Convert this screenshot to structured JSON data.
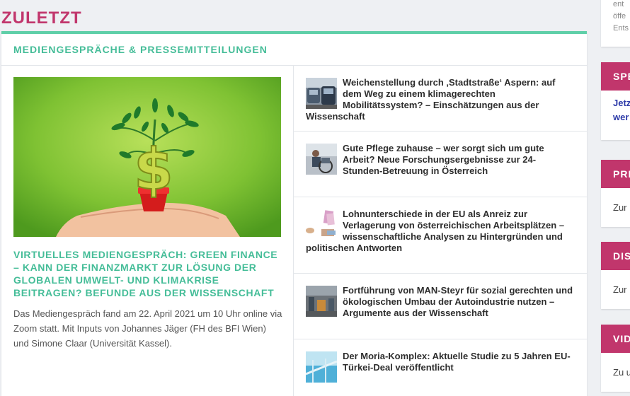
{
  "section": {
    "title": "ZULETZT"
  },
  "card": {
    "header": "MEDIENGESPRÄCHE & PRESSEMITTEILUNGEN",
    "featured": {
      "image": "green-finance-plant-dollar-image",
      "title": "VIRTUELLES MEDIENGESPRÄCH: GREEN FINANCE – KANN DER FINANZMARKT ZUR LÖSUNG DER GLOBALEN UMWELT- UND KLIMAKRISE BEITRAGEN? BEFUNDE AUS DER WISSENSCHAFT",
      "text": "Das Mediengespräch fand am 22. April 2021 um 10 Uhr online via Zoom statt. Mit Inputs von Johannes Jäger (FH des BFI Wien) und Simone Claar (Universität Kassel)."
    },
    "items": [
      {
        "thumb": "traffic-cars-thumbnail",
        "title": "Weichenstellung durch ‚Stadtstraße‘ Aspern: auf dem Weg zu einem klimagerechten Mobilitätssystem? – Einschätzungen aus der Wissenschaft"
      },
      {
        "thumb": "wheelchair-care-thumbnail",
        "title": "Gute Pflege zuhause – wer sorgt sich um gute Arbeit? Neue Forschungsergebnisse zur 24-Stunden-Betreuung in Österreich"
      },
      {
        "thumb": "euro-banknotes-thumbnail",
        "title": "Lohnunterschiede in der EU als Anreiz zur Verlagerung von österreichischen Arbeitsplätzen – wissenschaftliche Analysen zu Hintergründen und politischen Antworten"
      },
      {
        "thumb": "factory-hall-thumbnail",
        "title": "Fortführung von MAN-Steyr für sozial gerechten und ökologischen Umbau der Autoindustrie nutzen – Argumente aus der Wissenschaft"
      },
      {
        "thumb": "fence-sky-thumbnail",
        "title": "Der Moria-Komplex: Aktuelle Studie zu 5 Jahren EU-Türkei-Deal veröffentlicht"
      }
    ]
  },
  "sidebar": {
    "top_fragment": [
      "ent",
      "öffe",
      "Ents"
    ],
    "boxes": [
      {
        "heading": "SPE",
        "link_lines": [
          "Jetz",
          "wer"
        ]
      },
      {
        "heading": "PRE",
        "text": "Zur"
      },
      {
        "heading": "DIS",
        "text": "Zur"
      },
      {
        "heading": "VID",
        "text": "Zu u"
      }
    ]
  },
  "colors": {
    "accent_pink": "#c1366c",
    "accent_green": "#45bd98",
    "card_border": "#5fcfa8",
    "link_blue": "#2c3aa8"
  }
}
